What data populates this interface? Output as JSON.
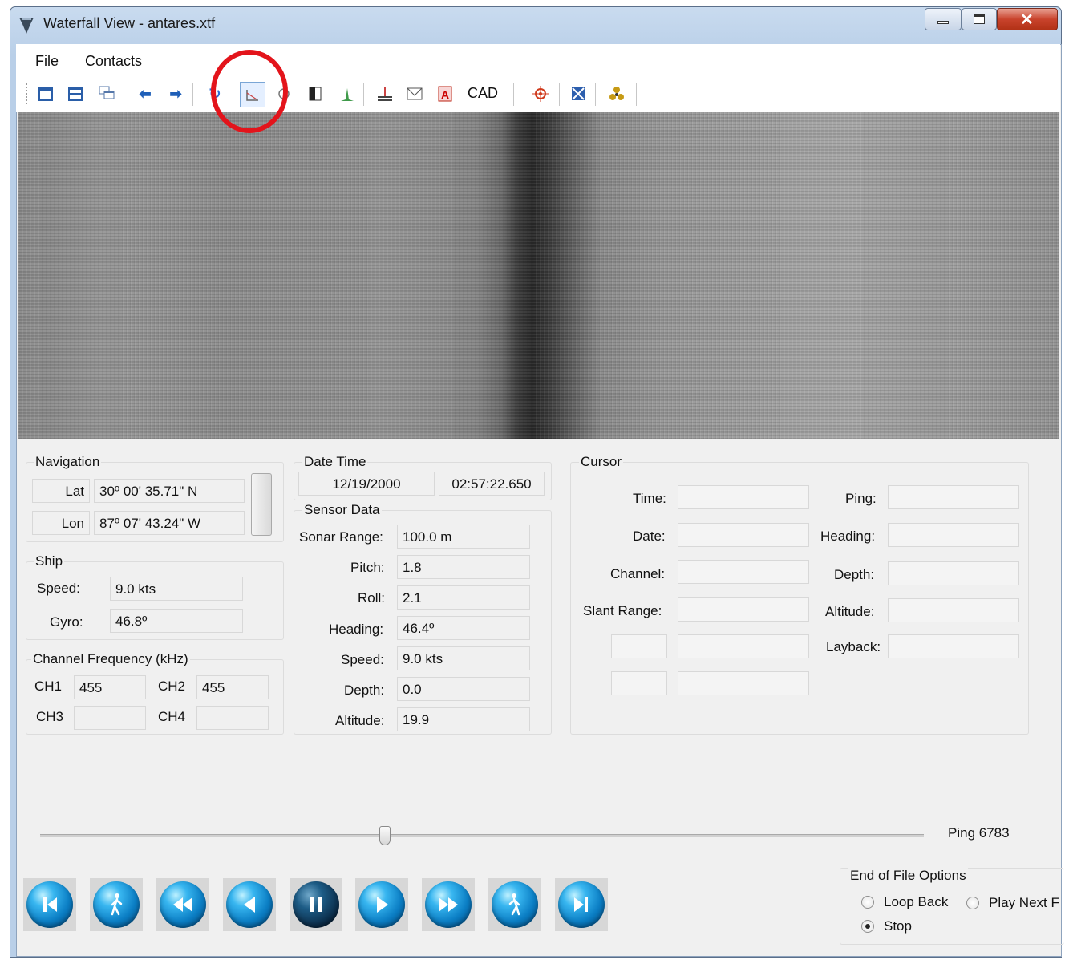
{
  "window": {
    "title": "Waterfall View - antares.xtf"
  },
  "menu": {
    "file": "File",
    "contacts": "Contacts"
  },
  "toolbar": {
    "cad_label": "CAD"
  },
  "navigation": {
    "group_label": "Navigation",
    "lat_label": "Lat",
    "lat_value": "30º 00' 35.71\" N",
    "lon_label": "Lon",
    "lon_value": "87º 07' 43.24\" W"
  },
  "ship": {
    "group_label": "Ship",
    "speed_label": "Speed:",
    "speed_value": "9.0 kts",
    "gyro_label": "Gyro:",
    "gyro_value": "46.8º"
  },
  "channel_frequency": {
    "group_label": "Channel Frequency (kHz)",
    "ch1_label": "CH1",
    "ch1_value": "455",
    "ch2_label": "CH2",
    "ch2_value": "455",
    "ch3_label": "CH3",
    "ch3_value": "",
    "ch4_label": "CH4",
    "ch4_value": ""
  },
  "date_time": {
    "group_label": "Date Time",
    "date": "12/19/2000",
    "time": "02:57:22.650"
  },
  "sensor_data": {
    "group_label": "Sensor Data",
    "sonar_range_label": "Sonar Range:",
    "sonar_range_value": "100.0 m",
    "pitch_label": "Pitch:",
    "pitch_value": "1.8",
    "roll_label": "Roll:",
    "roll_value": "2.1",
    "heading_label": "Heading:",
    "heading_value": "46.4º",
    "speed_label": "Speed:",
    "speed_value": "9.0 kts",
    "depth_label": "Depth:",
    "depth_value": "0.0",
    "altitude_label": "Altitude:",
    "altitude_value": "19.9"
  },
  "cursor": {
    "group_label": "Cursor",
    "time_label": "Time:",
    "date_label": "Date:",
    "channel_label": "Channel:",
    "slant_range_label": "Slant Range:",
    "ping_label": "Ping:",
    "heading_label": "Heading:",
    "depth_label": "Depth:",
    "altitude_label": "Altitude:",
    "layback_label": "Layback:"
  },
  "playback": {
    "ping_text": "Ping 6783",
    "position_fraction": 0.39
  },
  "end_of_file": {
    "group_label": "End of File Options",
    "loop_back": "Loop Back",
    "play_next": "Play Next F",
    "stop": "Stop",
    "selected": "Stop"
  },
  "colors": {
    "cursor_line": "#39d0e0",
    "highlight_circle": "#e3141b",
    "transport_blue": "#0b7ec4"
  }
}
